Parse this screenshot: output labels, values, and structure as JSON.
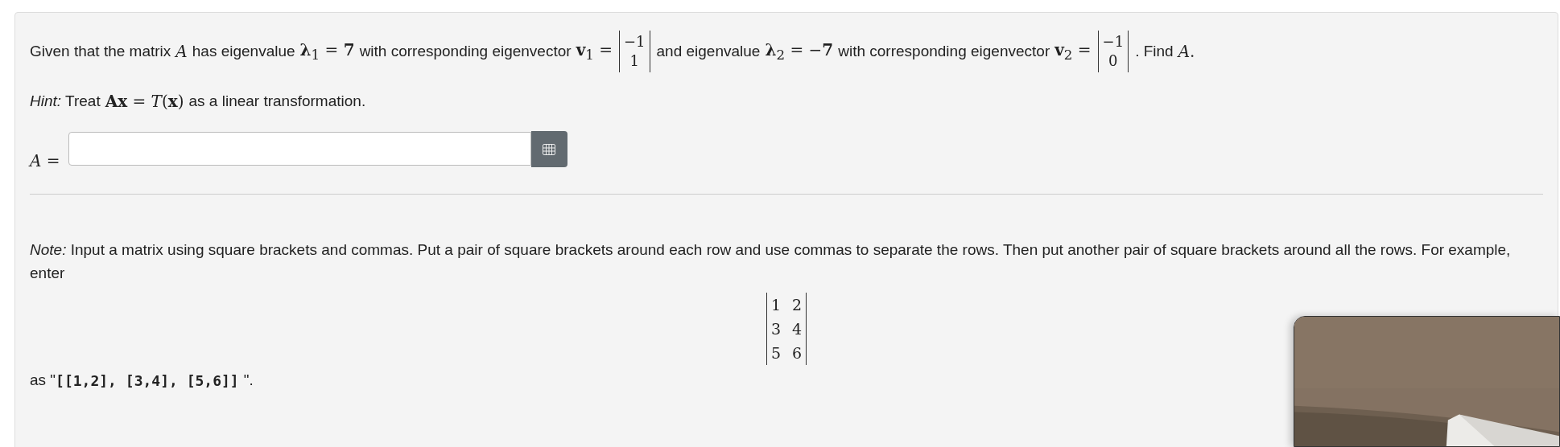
{
  "question": {
    "segments": [
      {
        "kind": "text",
        "text": "Given that the matrix"
      },
      {
        "kind": "math",
        "text": "*A*"
      },
      {
        "kind": "text",
        "text": "has eigenvalue"
      },
      {
        "kind": "math",
        "text": "**λ**$_{1}$ = **7**"
      },
      {
        "kind": "text",
        "text": "with corresponding eigenvector"
      },
      {
        "kind": "math",
        "text": "**v**$_{1}$ ="
      },
      {
        "kind": "matrix",
        "rows": [
          [
            "−1"
          ],
          [
            "1"
          ]
        ]
      },
      {
        "kind": "text",
        "text": "and eigenvalue"
      },
      {
        "kind": "math",
        "text": "**λ**$_{2}$ = −**7**"
      },
      {
        "kind": "text",
        "text": "with corresponding eigenvector"
      },
      {
        "kind": "math",
        "text": "**v**$_{2}$ ="
      },
      {
        "kind": "matrix",
        "rows": [
          [
            "−1"
          ],
          [
            "0"
          ]
        ]
      },
      {
        "kind": "text",
        "text": ". Find"
      },
      {
        "kind": "math",
        "text": "*A*."
      }
    ]
  },
  "hint": {
    "segments": [
      {
        "kind": "text",
        "text": "*Hint:* Treat"
      },
      {
        "kind": "math",
        "text": "**Ax** = *T*(**x**)"
      },
      {
        "kind": "text",
        "text": "as a linear transformation."
      }
    ]
  },
  "answer": {
    "label": "*A* ="
  },
  "note": "*Note:* Input a matrix using square brackets and commas. Put a pair of square brackets around each row and use commas to separate the rows. Then put another pair of square brackets around all the rows. For example, enter",
  "example_matrix": {
    "rows": [
      [
        "1",
        "2"
      ],
      [
        "3",
        "4"
      ],
      [
        "5",
        "6"
      ]
    ]
  },
  "example": {
    "segments": [
      {
        "kind": "text",
        "text": "as \""
      },
      {
        "kind": "code",
        "text": "[[1,2], [3,4], [5,6]]"
      },
      {
        "kind": "text",
        "text": "\"."
      }
    ]
  }
}
